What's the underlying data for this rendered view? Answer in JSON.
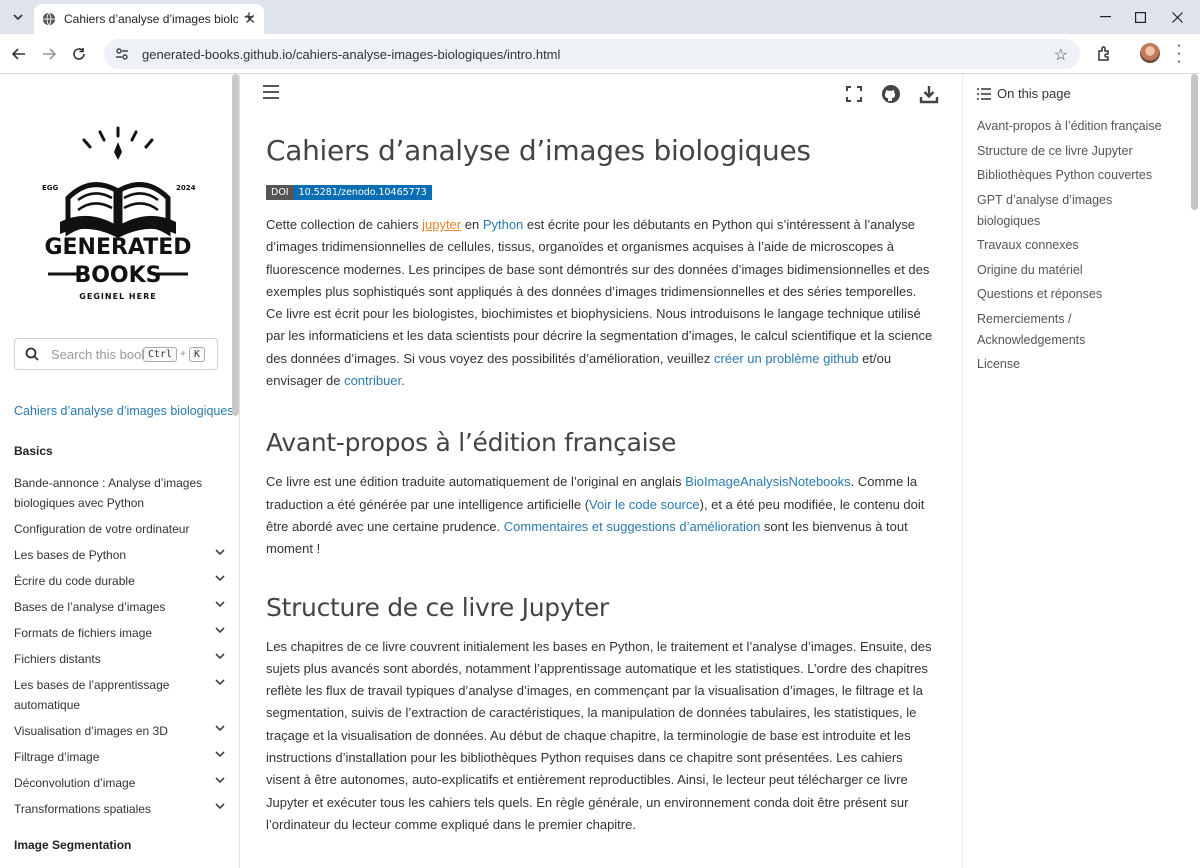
{
  "browser": {
    "tab_title": "Cahiers d’analyse d’images biolo",
    "url": "generated-books.github.io/cahiers-analyse-images-biologiques/intro.html"
  },
  "sidebar": {
    "logo": {
      "year_left": "EGG",
      "year_right": "2024",
      "line1": "GENERATED",
      "line2": "BOOKS",
      "tagline": "GEGINEL HERE"
    },
    "search_placeholder": "Search this book...",
    "shortcut_key1": "Ctrl",
    "shortcut_plus": "+",
    "shortcut_key2": "K",
    "root_link": "Cahiers d’analyse d’images biologiques",
    "caption_basics": "Basics",
    "caption_segmentation": "Image Segmentation",
    "items": [
      {
        "label": "Bande-annonce : Analyse d’images biologiques avec Python",
        "expandable": false
      },
      {
        "label": "Configuration de votre ordinateur",
        "expandable": false
      },
      {
        "label": "Les bases de Python",
        "expandable": true
      },
      {
        "label": "Écrire du code durable",
        "expandable": true
      },
      {
        "label": "Bases de l’analyse d’images",
        "expandable": true
      },
      {
        "label": "Formats de fichiers image",
        "expandable": true
      },
      {
        "label": "Fichiers distants",
        "expandable": true
      },
      {
        "label": "Les bases de l’apprentissage automatique",
        "expandable": true
      },
      {
        "label": "Visualisation d’images en 3D",
        "expandable": true
      },
      {
        "label": "Filtrage d’image",
        "expandable": true
      },
      {
        "label": "Déconvolution d’image",
        "expandable": true
      },
      {
        "label": "Transformations spatiales",
        "expandable": true
      }
    ]
  },
  "article": {
    "title": "Cahiers d’analyse d’images biologiques",
    "doi_label": "DOI",
    "doi_value": "10.5281/zenodo.10465773",
    "intro": {
      "t1": "Cette collection de cahiers ",
      "link_jupyter": "jupyter",
      "t2": " en ",
      "link_python": "Python",
      "t3": " est écrite pour les débutants en Python qui s’intéressent à l’analyse d’images tridimensionnelles de cellules, tissus, organoïdes et organismes acquises à l’aide de microscopes à fluorescence modernes. Les principes de base sont démontrés sur des données d’images bidimensionnelles et des exemples plus sophistiqués sont appliqués à des données d’images tridimensionnelles et des séries temporelles. Ce livre est écrit pour les biologistes, biochimistes et biophysiciens. Nous introduisons le langage technique utilisé par les informaticiens et les data scientists pour décrire la segmentation d’images, le calcul scientifique et la science des données d’images. Si vous voyez des possibilités d’amélioration, veuillez ",
      "link_issue": "créer un problème github",
      "t4": " et/ou envisager de ",
      "link_contrib": "contribuer",
      "t5": "."
    },
    "h2_foreword": "Avant-propos à l’édition française",
    "foreword": {
      "t1": "Ce livre est une édition traduite automatiquement de l’original en anglais ",
      "link_orig": "BioImageAnalysisNotebooks",
      "t2": ". Comme la traduction a été générée par une intelligence artificielle (",
      "link_source": "Voir le code source",
      "t3": "), et a été peu modifiée, le contenu doit être abordé avec une certaine prudence. ",
      "link_feedback": "Commentaires et suggestions d’amélioration",
      "t4": " sont les bienvenus à tout moment !"
    },
    "h2_structure": "Structure de ce livre Jupyter",
    "structure_text": "Les chapitres de ce livre couvrent initialement les bases en Python, le traitement et l’analyse d’images. Ensuite, des sujets plus avancés sont abordés, notamment l’apprentissage automatique et les statistiques. L’ordre des chapitres reflète les flux de travail typiques d’analyse d’images, en commençant par la visualisation d’images, le filtrage et la segmentation, suivis de l’extraction de caractéristiques, la manipulation de données tabulaires, les statistiques, le traçage et la visualisation de données. Au début de chaque chapitre, la terminologie de base est introduite et les instructions d’installation pour les bibliothèques Python requises dans ce chapitre sont présentées. Les cahiers visent à être autonomes, auto-explicatifs et entièrement reproductibles. Ainsi, le lecteur peut télécharger ce livre Jupyter et exécuter tous les cahiers tels quels. En règle générale, un environnement conda doit être présent sur l’ordinateur du lecteur comme expliqué dans le premier chapitre."
  },
  "toc": {
    "heading": "On this page",
    "items": [
      "Avant-propos à l’édition française",
      "Structure de ce livre Jupyter",
      "Bibliothèques Python couvertes",
      "GPT d’analyse d’images biologiques",
      "Travaux connexes",
      "Origine du matériel",
      "Questions et réponses",
      "Remerciements / Acknowledgements",
      "License"
    ]
  },
  "colors": {
    "link": "#2a7ab0",
    "link_visited_accent": "#e8832a",
    "doi_blue": "#0a6eb4"
  }
}
